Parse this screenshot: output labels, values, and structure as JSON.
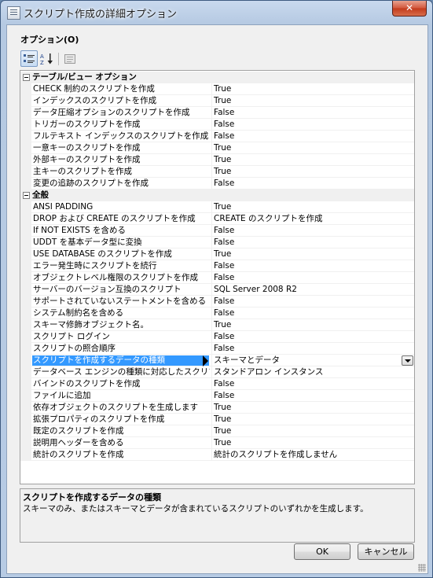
{
  "window": {
    "title": "スクリプト作成の詳細オプション",
    "close_label": "✕"
  },
  "options_heading": "オプション(O)",
  "toolbar": {
    "categorized_icon": "categorized-icon",
    "alphabetical_icon": "alphabetical-icon",
    "property_pages_icon": "property-pages-icon"
  },
  "grid": {
    "rows": [
      {
        "type": "category",
        "name": "テーブル/ビュー オプション"
      },
      {
        "name": "CHECK 制約のスクリプトを作成",
        "value": "True"
      },
      {
        "name": "インデックスのスクリプトを作成",
        "value": "True"
      },
      {
        "name": "データ圧縮オプションのスクリプトを作成",
        "value": "False"
      },
      {
        "name": "トリガーのスクリプトを作成",
        "value": "False"
      },
      {
        "name": "フルテキスト インデックスのスクリプトを作成",
        "value": "False"
      },
      {
        "name": "一意キーのスクリプトを作成",
        "value": "True"
      },
      {
        "name": "外部キーのスクリプトを作成",
        "value": "True"
      },
      {
        "name": "主キーのスクリプトを作成",
        "value": "True"
      },
      {
        "name": "変更の追跡のスクリプトを作成",
        "value": "False"
      },
      {
        "type": "category",
        "name": "全般"
      },
      {
        "name": "ANSI PADDING",
        "value": "True"
      },
      {
        "name": "DROP および CREATE のスクリプトを作成",
        "value": "CREATE のスクリプトを作成"
      },
      {
        "name": "If NOT EXISTS を含める",
        "value": "False"
      },
      {
        "name": "UDDT を基本データ型に変換",
        "value": "False"
      },
      {
        "name": "USE DATABASE のスクリプトを作成",
        "value": "True"
      },
      {
        "name": "エラー発生時にスクリプトを続行",
        "value": "False"
      },
      {
        "name": "オブジェクトレベル権限のスクリプトを作成",
        "value": "False"
      },
      {
        "name": "サーバーのバージョン互換のスクリプト",
        "value": "SQL Server 2008 R2"
      },
      {
        "name": "サポートされていないステートメントを含める",
        "value": "False"
      },
      {
        "name": "システム制約名を含める",
        "value": "False"
      },
      {
        "name": "スキーマ修飾オブジェクト名。",
        "value": "True"
      },
      {
        "name": "スクリプト ログイン",
        "value": "False"
      },
      {
        "name": "スクリプトの照合順序",
        "value": "False"
      },
      {
        "name": "スクリプトを作成するデータの種類",
        "value": "スキーマとデータ",
        "selected": true
      },
      {
        "name": "データベース エンジンの種類に対応したスクリプト",
        "value": "スタンドアロン インスタンス"
      },
      {
        "name": "バインドのスクリプトを作成",
        "value": "False"
      },
      {
        "name": "ファイルに追加",
        "value": "False"
      },
      {
        "name": "依存オブジェクトのスクリプトを生成します",
        "value": "True"
      },
      {
        "name": "拡張プロパティのスクリプトを作成",
        "value": "True"
      },
      {
        "name": "既定のスクリプトを作成",
        "value": "True"
      },
      {
        "name": "説明用ヘッダーを含める",
        "value": "True"
      },
      {
        "name": "統計のスクリプトを作成",
        "value": "統計のスクリプトを作成しません"
      }
    ]
  },
  "description": {
    "title": "スクリプトを作成するデータの種類",
    "text": "スキーマのみ、またはスキーマとデータが含まれているスクリプトのいずれかを生成します。"
  },
  "buttons": {
    "ok": "OK",
    "cancel": "キャンセル"
  }
}
